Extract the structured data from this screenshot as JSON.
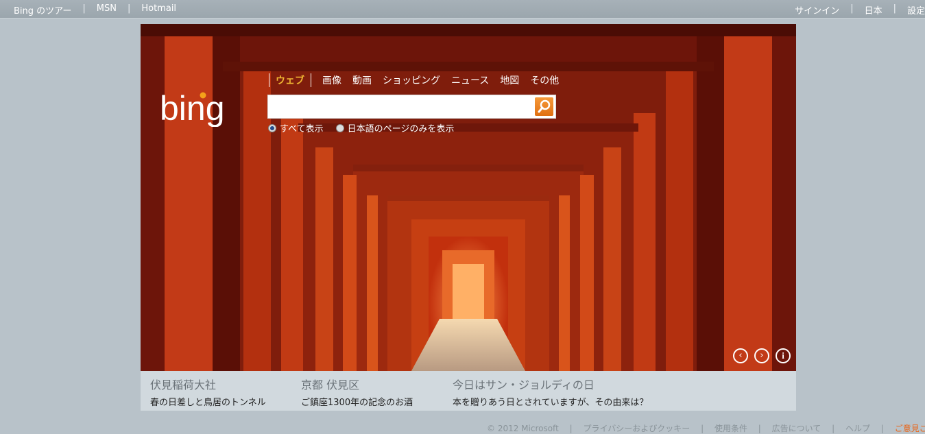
{
  "topbar": {
    "left_links": [
      "Bing のツアー",
      "MSN",
      "Hotmail"
    ],
    "right_links": [
      "サインイン",
      "日本",
      "設定"
    ]
  },
  "search": {
    "verticals": [
      "ウェブ",
      "画像",
      "動画",
      "ショッピング",
      "ニュース",
      "地図",
      "その他"
    ],
    "placeholder": "",
    "scope_all": "すべて表示",
    "scope_japanese": "日本語のページのみを表示"
  },
  "logo_text": "bing",
  "hero_nav": {
    "prev_icon": "chevron-left-icon",
    "next_icon": "chevron-right-icon",
    "info_icon": "info-icon"
  },
  "hotspots": [
    {
      "title": "伏見稲荷大社",
      "desc": "春の日差しと鳥居のトンネル"
    },
    {
      "title": "京都 伏見区",
      "desc": "ご鎮座1300年の記念のお酒"
    },
    {
      "title": "今日はサン・ジョルディの日",
      "desc": "本を贈りあう日とされていますが、その由来は？"
    }
  ],
  "footer": {
    "copyright": "© 2012 Microsoft",
    "links": [
      "プライバシーおよびクッキー",
      "使用条件",
      "広告について",
      "ヘルプ"
    ],
    "feedback": "ご意見ご感想"
  },
  "colors": {
    "accent_active_tab": "#f0b733",
    "search_button": "#e07011",
    "feedback_link": "#e9661a"
  }
}
